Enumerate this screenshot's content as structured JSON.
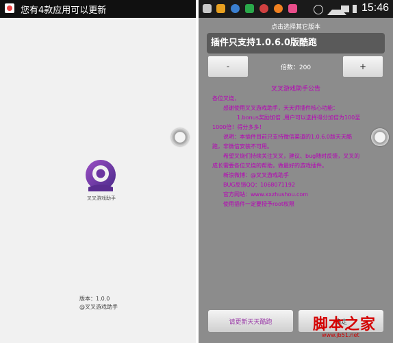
{
  "left_screen": {
    "notification_text": "您有4款应用可以更新",
    "app_name": "叉叉游戏助手",
    "version_text": "版本：1.0.0",
    "copyright_text": "@叉叉游戏助手"
  },
  "right_screen": {
    "status_time": "15:46",
    "hint_text": "点击选择其它版本",
    "plugin_title": "插件只支持1.0.6.0版酷跑",
    "minus_label": "-",
    "plus_label": "+",
    "multiplier_text": "倍数：200",
    "notice": {
      "title": "叉叉游戏助手公告",
      "lines": [
        "各位叉烧，",
        "感谢使用叉叉游戏助手，天天师插件核心功能：",
        "1.bonus奖励加倍 ,用户可以选择得分加倍为100至",
        "1000倍！得分多多！",
        "说明：本插件目前只支持微信渠道的1.0.6.0版天天酷",
        "跑，非微信安装不可用。",
        "希望叉烧们持续关注叉叉，建议、bug随时反馈，叉叉的",
        "成长需要各位叉烧的帮助，做最好的游戏插件。",
        "新浪微博：@叉叉游戏助手",
        "BUG反馈QQ：1068071192",
        "官方网站：www.xxzhushou.com",
        "使用插件一定要授予root权限"
      ]
    },
    "update_button": "请更新天天酷跑",
    "second_button": "确定"
  },
  "watermark": {
    "text": "脚本之家",
    "url": "www.jb51.net"
  },
  "colors": {
    "notice_text": "#b700b7",
    "right_bg": "#8c8c8c",
    "left_bg": "#f1f1f1",
    "logo_purple": "#7a3fa0"
  }
}
